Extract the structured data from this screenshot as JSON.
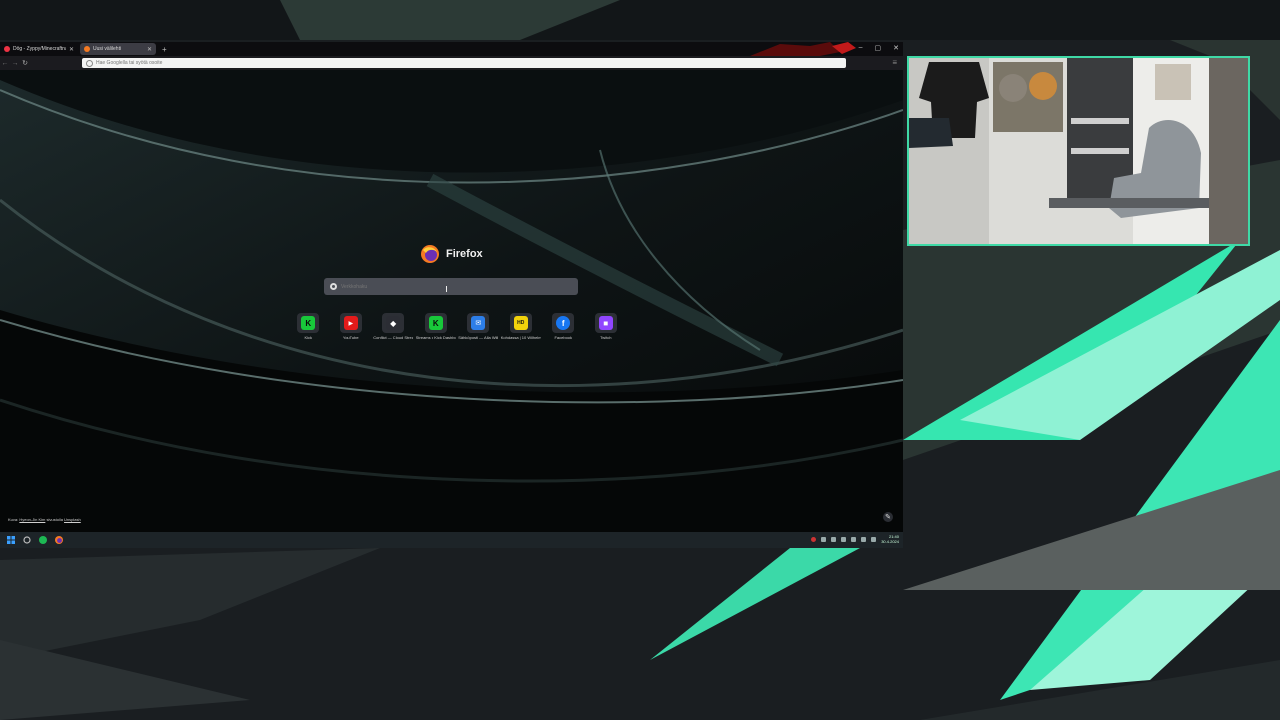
{
  "window": {
    "tabs": [
      {
        "title": "Dōg - Zyppy/Minecraftnaffe"
      },
      {
        "title": "Uusi välilehti"
      }
    ],
    "new_tab_label": "+",
    "controls": {
      "minimize": "–",
      "maximize": "▢",
      "close": "✕"
    }
  },
  "toolbar": {
    "back": "←",
    "forward": "→",
    "reload": "↻",
    "url_placeholder": "Hae Googlella tai syötä osoite",
    "menu": "≡"
  },
  "newtab": {
    "brand": "Firefox",
    "search_placeholder": "Verkkohaku",
    "shortcuts": [
      {
        "label": "Kick",
        "icon": "kick-icon",
        "glyph": "K",
        "color": "#18c83a"
      },
      {
        "label": "YouTube",
        "icon": "youtube-icon",
        "glyph": "▶",
        "color": "#e41b1b"
      },
      {
        "label": "Conflict — Cloud Streaming Re...",
        "icon": "streaming-icon",
        "glyph": "◆",
        "color": "#2b2d34"
      },
      {
        "label": "Streams • Kick Dashboard",
        "icon": "kick-icon",
        "glyph": "K",
        "color": "#18c83a"
      },
      {
        "label": "Sähköposti — Alla Wilhelmssen...",
        "icon": "mail-icon",
        "glyph": "✉",
        "color": "#2d7ee8"
      },
      {
        "label": "Kohdassa | 10 Wilhelmssen...",
        "icon": "hd-icon",
        "glyph": "HD",
        "color": "#f2d20c"
      },
      {
        "label": "Facebook",
        "icon": "facebook-icon",
        "glyph": "f",
        "color": "#1877f2"
      },
      {
        "label": "Twitch",
        "icon": "twitch-icon",
        "glyph": "◼",
        "color": "#9146ff"
      }
    ],
    "photo_credit_prefix": "Kuva: ",
    "photo_credit_author": "Hyeon-Jin Kim",
    "photo_credit_mid": " sivustolla ",
    "photo_credit_site": "Unsplash"
  },
  "taskbar": {
    "time": "21:40",
    "date": "30.4.2024"
  }
}
